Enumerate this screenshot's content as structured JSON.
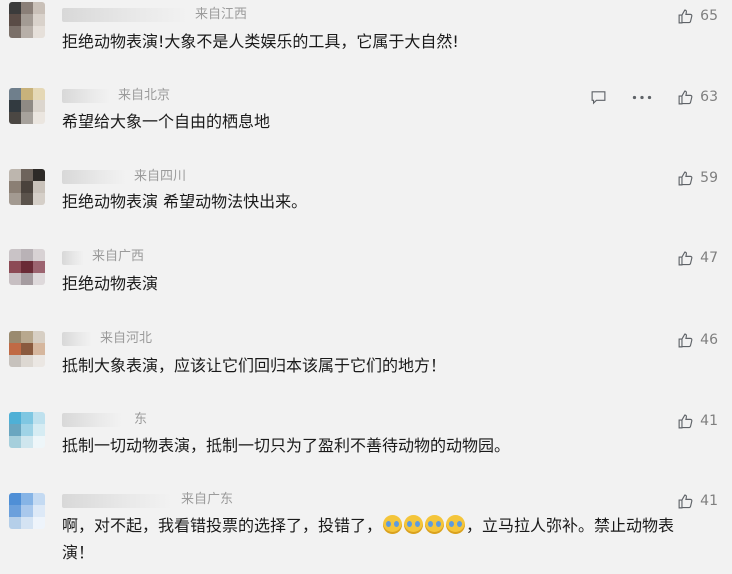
{
  "comments": [
    {
      "location": "来自江西",
      "text": "拒绝动物表演!大象不是人类娱乐的工具，它属于大自然!",
      "likes": "65"
    },
    {
      "location": "来自北京",
      "text": "希望给大象一个自由的栖息地",
      "likes": "63"
    },
    {
      "location": "来自四川",
      "text": "拒绝动物表演 希望动物法快出来。",
      "likes": "59"
    },
    {
      "location": "来自广西",
      "text": "拒绝动物表演",
      "likes": "47"
    },
    {
      "location": "来自河北",
      "text": "抵制大象表演，应该让它们回归本该属于它们的地方！",
      "likes": "46"
    },
    {
      "location": "东",
      "text": "抵制一切动物表演，抵制一切只为了盈利不善待动物的动物园。",
      "likes": "41"
    },
    {
      "location": "来自广东",
      "text_before": "啊，对不起，我看错投票的选择了，投错了，",
      "text_after": "，立马拉人弥补。禁止动物表演！",
      "likes": "41"
    }
  ],
  "icons": {
    "like": "thumbs-up-icon",
    "reply": "comment-bubble-icon",
    "more": "more-dots-icon",
    "emoji": "crying-face-emoji"
  }
}
